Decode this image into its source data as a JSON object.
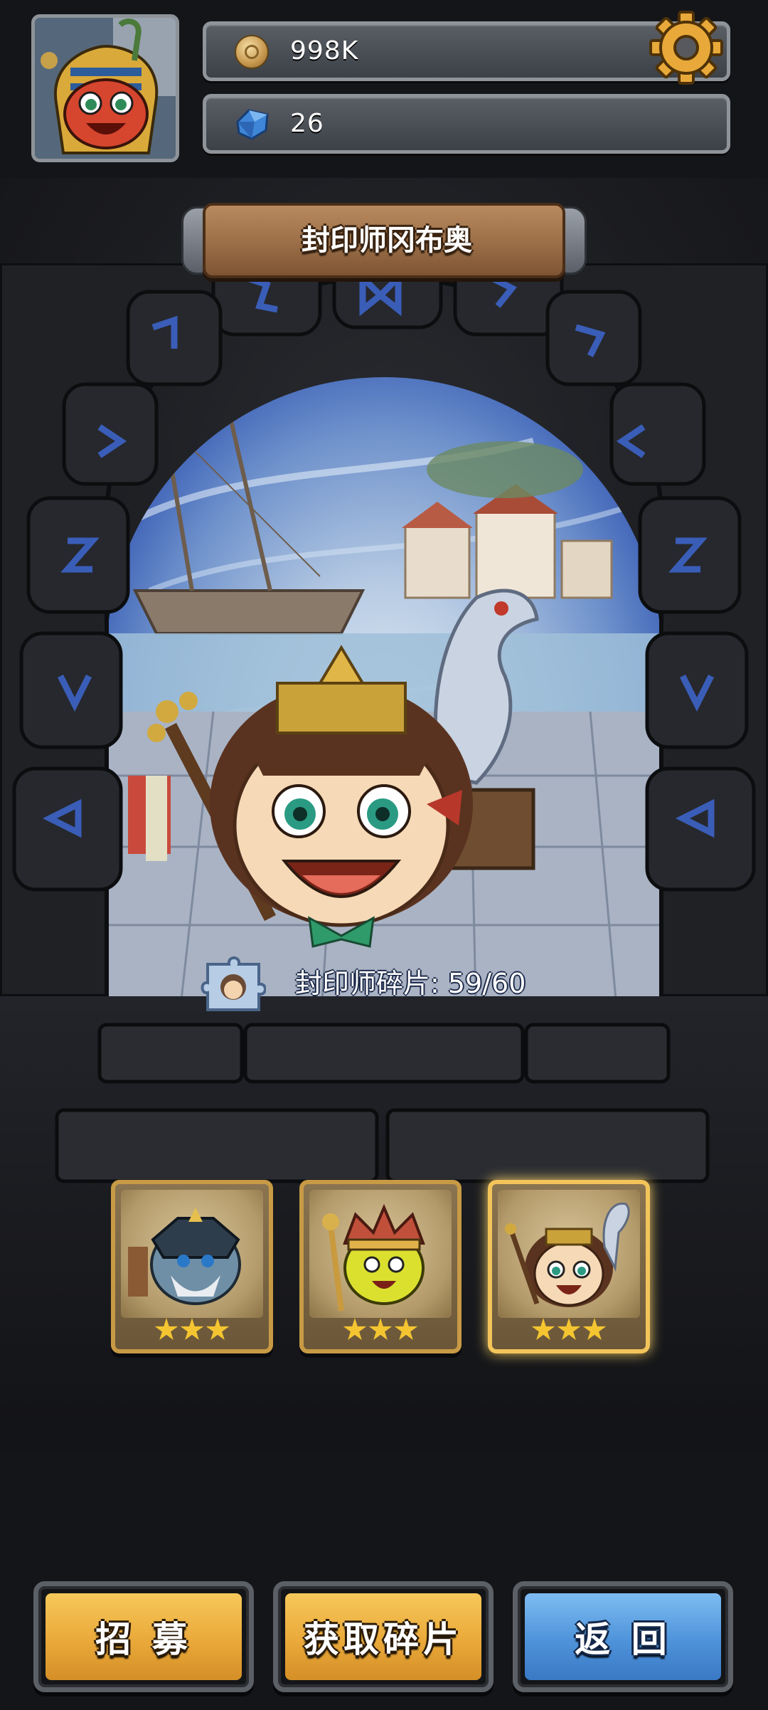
{
  "currency": {
    "coins": "998K",
    "gems": "26"
  },
  "hero": {
    "name": "封印师冈布奥",
    "shard_progress": "封印师碎片: 59/60"
  },
  "cards": [
    {
      "name": "armored-warrior",
      "stars": 3
    },
    {
      "name": "crowned-king",
      "stars": 3
    },
    {
      "name": "sealer",
      "stars": 3,
      "selected": true
    }
  ],
  "buttons": {
    "recruit": "招 募",
    "get_shards": "获取碎片",
    "back": "返 回"
  },
  "colors": {
    "gold_button": "#eaa93a",
    "blue_button": "#4e93da",
    "portal_blue": "#2b4fae",
    "plank_wood": "#9b6e47"
  },
  "icons": {
    "coins": "coin-icon",
    "gems": "gem-icon",
    "settings": "gear-icon",
    "shard": "puzzle-shard-icon"
  }
}
